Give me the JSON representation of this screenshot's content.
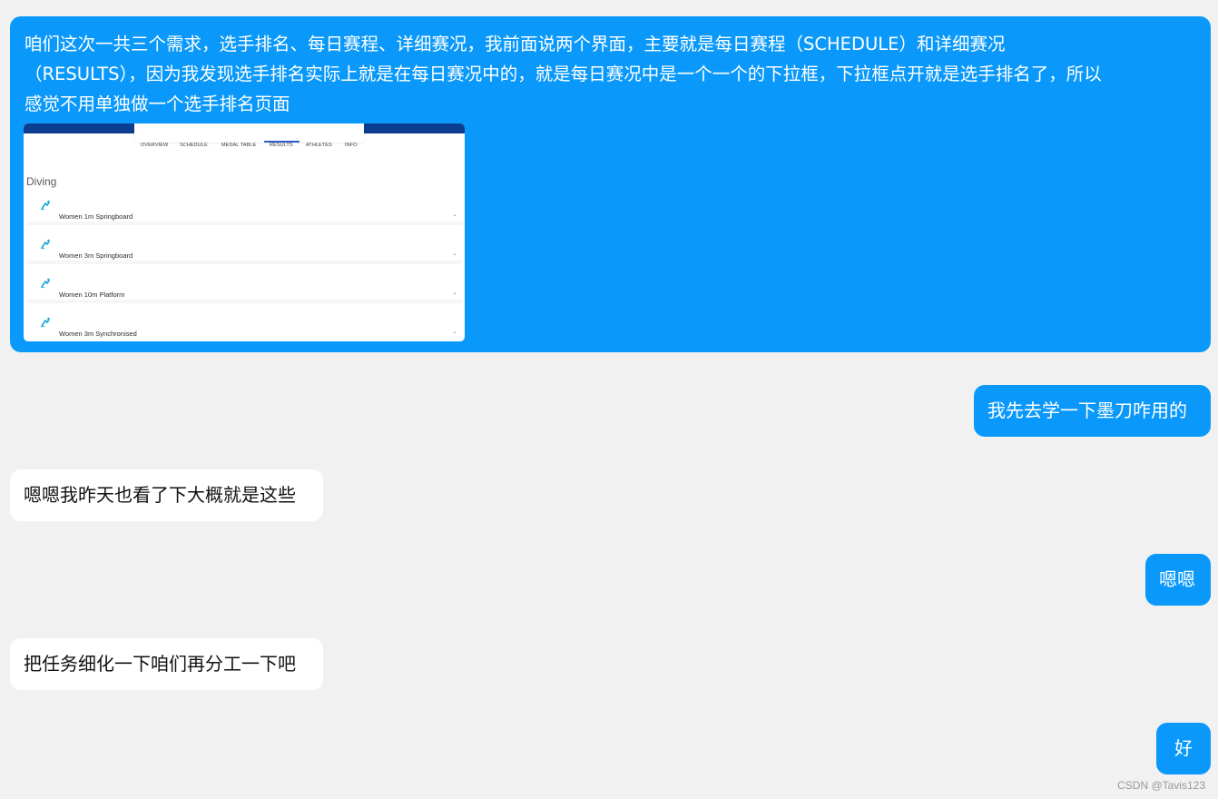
{
  "messages": [
    {
      "side": "right",
      "lines": [
        "咱们这次一共三个需求，选手排名、每日赛程、详细赛况，我前面说两个界面，主要就是每日赛程（SCHEDULE）和详细赛况",
        "（RESULTS），因为我发现选手排名实际上就是在每日赛况中的，就是每日赛况中是一个一个的下拉框，下拉框点开就是选手排名了，所以",
        "感觉不用单独做一个选手排名页面"
      ],
      "screenshot": {
        "tabs": [
          "OVERVIEW",
          "SCHEDULE",
          "MEDAL TABLE",
          "RESULTS",
          "ATHLETES",
          "INFO"
        ],
        "active_tab": "RESULTS",
        "sport": "Diving",
        "events": [
          "Women 1m Springboard",
          "Women 3m Springboard",
          "Women 10m Platform",
          "Women 3m Synchronised"
        ],
        "icon": "diving-icon",
        "chevron": "chevron-down-icon",
        "colors": {
          "header": "#0d3d8e",
          "active_tab": "#2c5fcf",
          "icon": "#1aa6d8"
        }
      }
    },
    {
      "side": "right",
      "text": "我先去学一下墨刀咋用的"
    },
    {
      "side": "left",
      "text": "嗯嗯我昨天也看了下大概就是这些"
    },
    {
      "side": "right",
      "text": "嗯嗯"
    },
    {
      "side": "left",
      "text": "把任务细化一下咱们再分工一下吧"
    },
    {
      "side": "right",
      "text": "好"
    }
  ],
  "watermark": "CSDN @Tavis123",
  "colors": {
    "background": "#f1f1f1",
    "right_bubble": "#0a99fb",
    "left_bubble": "#ffffff"
  }
}
